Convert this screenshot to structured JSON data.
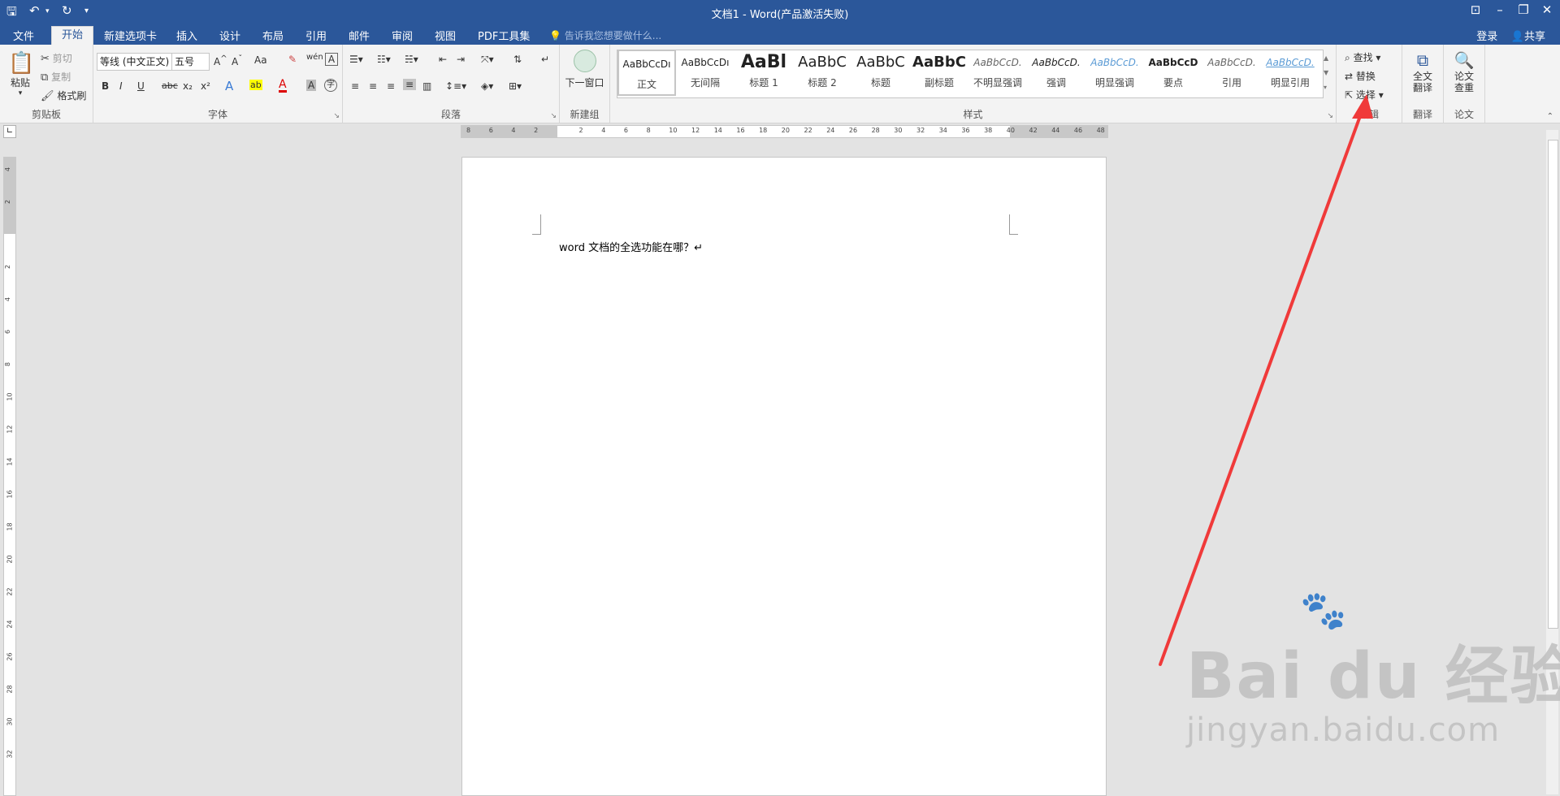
{
  "window": {
    "title": "文档1 - Word(产品激活失败)",
    "controls": [
      "restore-ribbon-icon",
      "minimize-icon",
      "maximize-icon",
      "close-icon"
    ]
  },
  "tabs": [
    {
      "label": "文件"
    },
    {
      "label": "开始",
      "active": true
    },
    {
      "label": "新建选项卡"
    },
    {
      "label": "插入"
    },
    {
      "label": "设计"
    },
    {
      "label": "布局"
    },
    {
      "label": "引用"
    },
    {
      "label": "邮件"
    },
    {
      "label": "审阅"
    },
    {
      "label": "视图"
    },
    {
      "label": "PDF工具集"
    }
  ],
  "tell_me": {
    "placeholder": "告诉我您想要做什么..."
  },
  "account": {
    "login": "登录",
    "share": "共享"
  },
  "clipboard": {
    "paste": "粘贴",
    "cut": "剪切",
    "copy": "复制",
    "format_painter": "格式刷",
    "label": "剪贴板"
  },
  "font": {
    "name": "等线 (中文正文)",
    "size": "五号",
    "label": "字体",
    "case_btn": "Aa"
  },
  "paragraph": {
    "label": "段落"
  },
  "new_group": {
    "next_window": "下一窗口",
    "label": "新建组"
  },
  "styles": {
    "label": "样式",
    "items": [
      {
        "preview": "AaBbCcDı",
        "name": "正文"
      },
      {
        "preview": "AaBbCcDı",
        "name": "无间隔"
      },
      {
        "preview": "AaBl",
        "name": "标题 1"
      },
      {
        "preview": "AaBbC",
        "name": "标题 2"
      },
      {
        "preview": "AaBbC",
        "name": "标题"
      },
      {
        "preview": "AaBbC",
        "name": "副标题"
      },
      {
        "preview": "AaBbCcD.",
        "name": "不明显强调"
      },
      {
        "preview": "AaBbCcD.",
        "name": "强调"
      },
      {
        "preview": "AaBbCcD.",
        "name": "明显强调"
      },
      {
        "preview": "AaBbCcD",
        "name": "要点"
      },
      {
        "preview": "AaBbCcD.",
        "name": "引用"
      },
      {
        "preview": "AaBbCcD.",
        "name": "明显引用"
      }
    ]
  },
  "editing": {
    "find": "查找",
    "replace": "替换",
    "select": "选择",
    "label": "编辑"
  },
  "translate": {
    "full": "全文翻译",
    "label": "翻译"
  },
  "thesis": {
    "check": "论文查重",
    "label": "论文"
  },
  "ruler": {
    "h_ticks": [
      "8",
      "6",
      "4",
      "2",
      "",
      "2",
      "4",
      "6",
      "8",
      "10",
      "12",
      "14",
      "16",
      "18",
      "20",
      "22",
      "24",
      "26",
      "28",
      "30",
      "32",
      "34",
      "36",
      "38",
      "40",
      "42",
      "44",
      "46",
      "48"
    ],
    "v_ticks": [
      "4",
      "2",
      "",
      "2",
      "4",
      "6",
      "8",
      "10",
      "12",
      "14",
      "16",
      "18",
      "20",
      "22",
      "24",
      "26",
      "28",
      "30",
      "32"
    ]
  },
  "document": {
    "text": "word 文档的全选功能在哪？↵"
  },
  "watermark": {
    "brand": "Bai du 经验",
    "url": "jingyan.baidu.com"
  },
  "colors": {
    "accent": "#2b579a",
    "arrow": "#f03a3a"
  }
}
